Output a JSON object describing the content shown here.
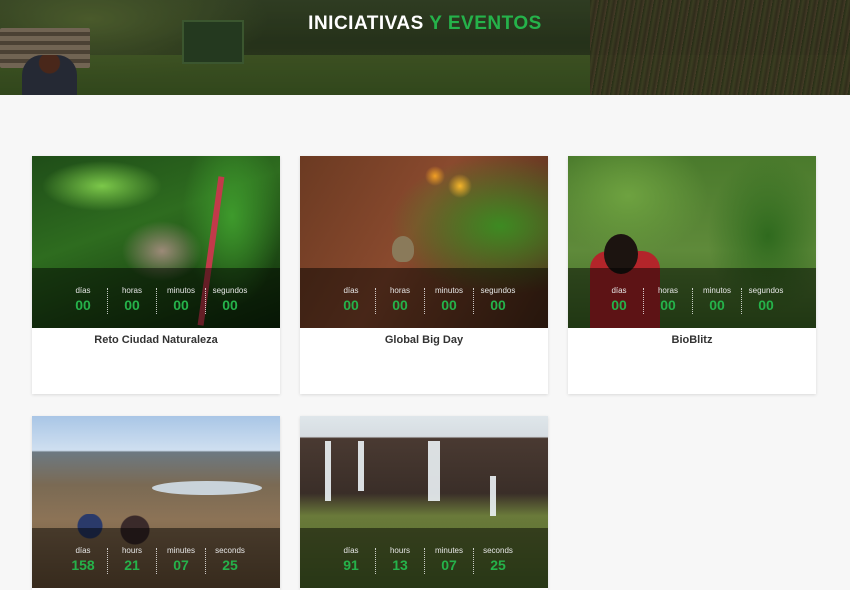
{
  "header": {
    "title_part1": "INICIATIVAS",
    "title_part2": "Y EVENTOS",
    "accent_color": "#25b24a"
  },
  "cards": [
    {
      "title": "Reto Ciudad Naturaleza",
      "labels": [
        "días",
        "horas",
        "minutos",
        "segundos"
      ],
      "values": [
        "00",
        "00",
        "00",
        "00"
      ]
    },
    {
      "title": "Global Big Day",
      "labels": [
        "días",
        "horas",
        "minutos",
        "segundos"
      ],
      "values": [
        "00",
        "00",
        "00",
        "00"
      ]
    },
    {
      "title": "BioBlitz",
      "labels": [
        "días",
        "horas",
        "minutos",
        "segundos"
      ],
      "values": [
        "00",
        "00",
        "00",
        "00"
      ]
    },
    {
      "title": "",
      "labels": [
        "días",
        "hours",
        "minutes",
        "seconds"
      ],
      "values": [
        "158",
        "21",
        "07",
        "25"
      ]
    },
    {
      "title": "",
      "labels": [
        "días",
        "hours",
        "minutes",
        "seconds"
      ],
      "values": [
        "91",
        "13",
        "07",
        "25"
      ]
    }
  ]
}
